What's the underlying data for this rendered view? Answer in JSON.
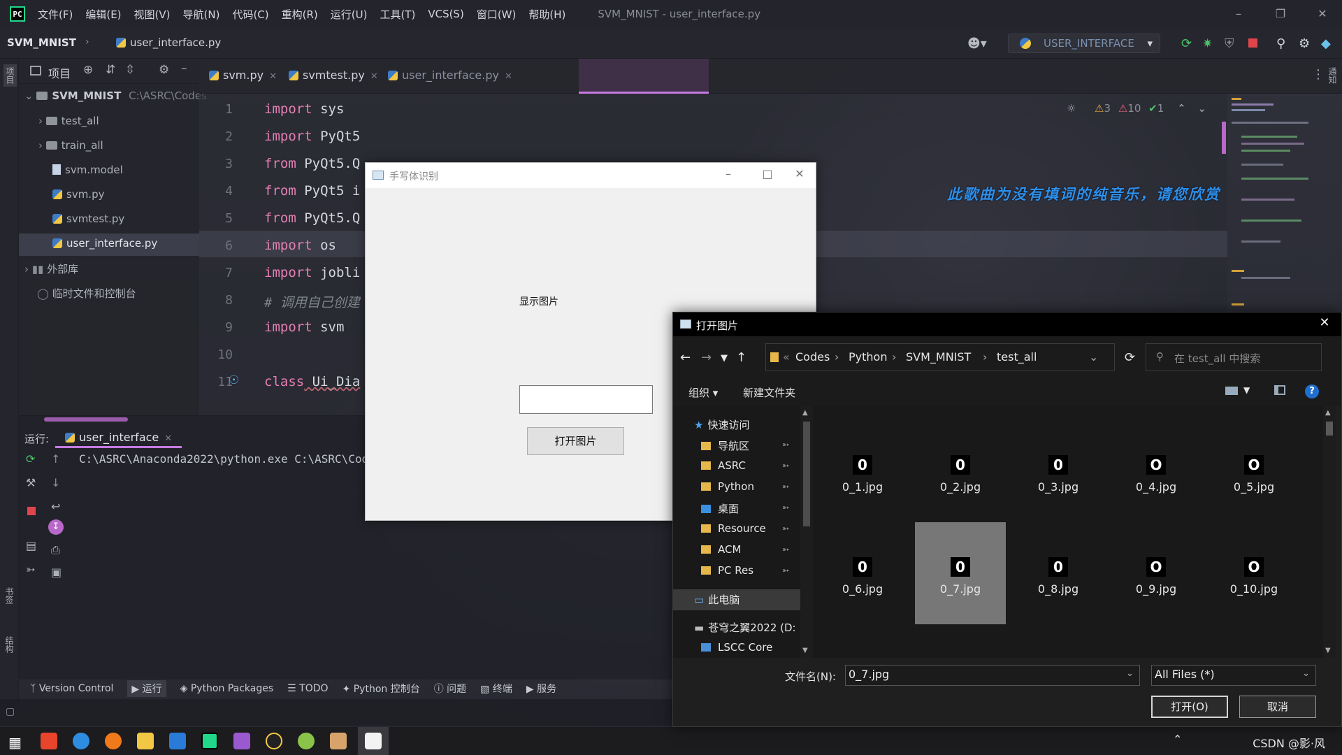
{
  "titlebar": {
    "menus": [
      "文件(F)",
      "编辑(E)",
      "视图(V)",
      "导航(N)",
      "代码(C)",
      "重构(R)",
      "运行(U)",
      "工具(T)",
      "VCS(S)",
      "窗口(W)",
      "帮助(H)"
    ],
    "window_title": "SVM_MNIST - user_interface.py"
  },
  "navbar": {
    "project": "SVM_MNIST",
    "file": "user_interface.py",
    "run_config": "USER_INTERFACE"
  },
  "left_strip": {
    "project_label": "项目",
    "bookmarks_label": "书签",
    "structure_label": "结构"
  },
  "project_panel": {
    "title": "项目",
    "root_name": "SVM_MNIST",
    "root_path": "C:\\ASRC\\Codes",
    "items": [
      {
        "name": "test_all",
        "type": "folder"
      },
      {
        "name": "train_all",
        "type": "folder"
      },
      {
        "name": "svm.model",
        "type": "file"
      },
      {
        "name": "svm.py",
        "type": "py"
      },
      {
        "name": "svmtest.py",
        "type": "py"
      },
      {
        "name": "user_interface.py",
        "type": "py"
      }
    ],
    "external_libs": "外部库",
    "scratches": "临时文件和控制台"
  },
  "editor": {
    "tabs": [
      {
        "label": "svm.py"
      },
      {
        "label": "svmtest.py"
      },
      {
        "label": "user_interface.py"
      }
    ],
    "lines": [
      {
        "n": "1",
        "kw": "import",
        "rest": " sys"
      },
      {
        "n": "2",
        "kw": "import",
        "rest": " PyQt5"
      },
      {
        "n": "3",
        "kw": "from",
        "rest": " PyQt5.Q"
      },
      {
        "n": "4",
        "kw": "from",
        "rest": " PyQt5 i"
      },
      {
        "n": "5",
        "kw": "from",
        "rest": " PyQt5.Q"
      },
      {
        "n": "6",
        "kw": "import",
        "rest": " os"
      },
      {
        "n": "7",
        "kw": "import",
        "rest": " jobli"
      },
      {
        "n": "8",
        "comment": "# 调用自己创建"
      },
      {
        "n": "9",
        "kw": "import",
        "rest": " svm"
      },
      {
        "n": "10",
        "kw": "",
        "rest": ""
      },
      {
        "n": "11",
        "kw": "class",
        "rest": " Ui_Dia"
      }
    ],
    "inspections": {
      "warn_weak": "3",
      "warn": "10",
      "ok": "1"
    },
    "lyric_overlay": "此歌曲为没有填词的纯音乐，请您欣赏"
  },
  "run_panel": {
    "label": "运行:",
    "tab": "user_interface",
    "console": "C:\\ASRC\\Anaconda2022\\python.exe C:\\ASRC\\Codes\\"
  },
  "bottom_tools": [
    "Version Control",
    "运行",
    "Python Packages",
    "TODO",
    "Python 控制台",
    "问题",
    "终端",
    "服务"
  ],
  "right_strip": {
    "notifications_label": "通知"
  },
  "qt_dialog": {
    "title": "手写体识别",
    "image_label": "显示图片",
    "input_value": "",
    "button": "打开图片"
  },
  "file_dialog": {
    "title": "打开图片",
    "path": [
      "Codes",
      "Python",
      "SVM_MNIST",
      "test_all"
    ],
    "search_placeholder": "在 test_all 中搜索",
    "organize": "组织",
    "new_folder": "新建文件夹",
    "sidebar": {
      "quick_access": "快速访问",
      "items": [
        "导航区",
        "ASRC",
        "Python",
        "桌面",
        "Resource",
        "ACM",
        "PC Res"
      ],
      "this_pc": "此电脑",
      "drive": "苍穹之翼2022 (D:",
      "lscc": "LSCC Core"
    },
    "files": [
      {
        "name": "0_1.jpg",
        "glyph": "0"
      },
      {
        "name": "0_2.jpg",
        "glyph": "0"
      },
      {
        "name": "0_3.jpg",
        "glyph": "0"
      },
      {
        "name": "0_4.jpg",
        "glyph": "O"
      },
      {
        "name": "0_5.jpg",
        "glyph": "O"
      },
      {
        "name": "0_6.jpg",
        "glyph": "0"
      },
      {
        "name": "0_7.jpg",
        "glyph": "0",
        "selected": true
      },
      {
        "name": "0_8.jpg",
        "glyph": "0"
      },
      {
        "name": "0_9.jpg",
        "glyph": "O"
      },
      {
        "name": "0_10.jpg",
        "glyph": "O"
      }
    ],
    "filename_label": "文件名(N):",
    "filename_value": "0_7.jpg",
    "filter_value": "All Files (*)",
    "open_button": "打开(O)",
    "cancel_button": "取消"
  },
  "taskbar": {
    "tray_text": "CSDN @影·风"
  },
  "colors": {
    "accent": "#c57be0",
    "keyword": "#e57fb4",
    "lyric": "#2e8fe8",
    "pycharm_green": "#21d789"
  }
}
